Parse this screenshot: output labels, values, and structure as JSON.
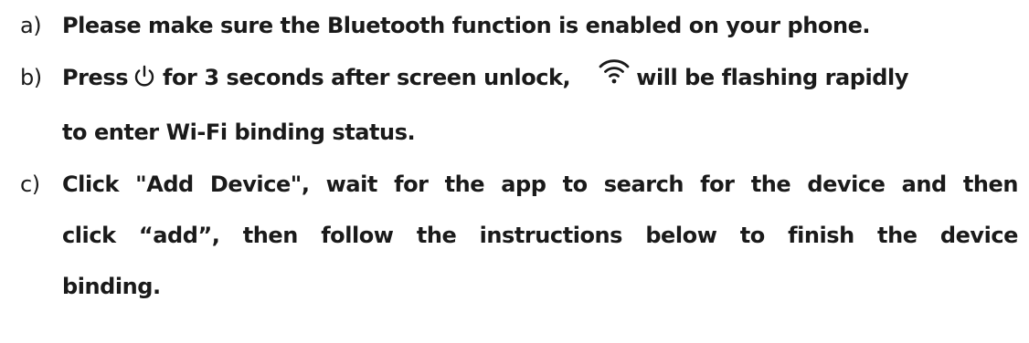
{
  "steps": [
    {
      "marker": "a)",
      "text": "Please make sure the Bluetooth function is enabled on your phone."
    },
    {
      "marker": "b)",
      "seg1": "Press",
      "seg2": "for 3 seconds after screen unlock,",
      "seg3": "will be flashing rapidly",
      "line2": "to enter Wi-Fi binding status.",
      "icons": [
        "power-icon",
        "wifi-icon"
      ]
    },
    {
      "marker": "c)",
      "line1": "Click \"Add Device\", wait for the app to search for the device and then",
      "line2": "click “add”, then follow the instructions below to finish the device",
      "line3": "binding."
    }
  ]
}
